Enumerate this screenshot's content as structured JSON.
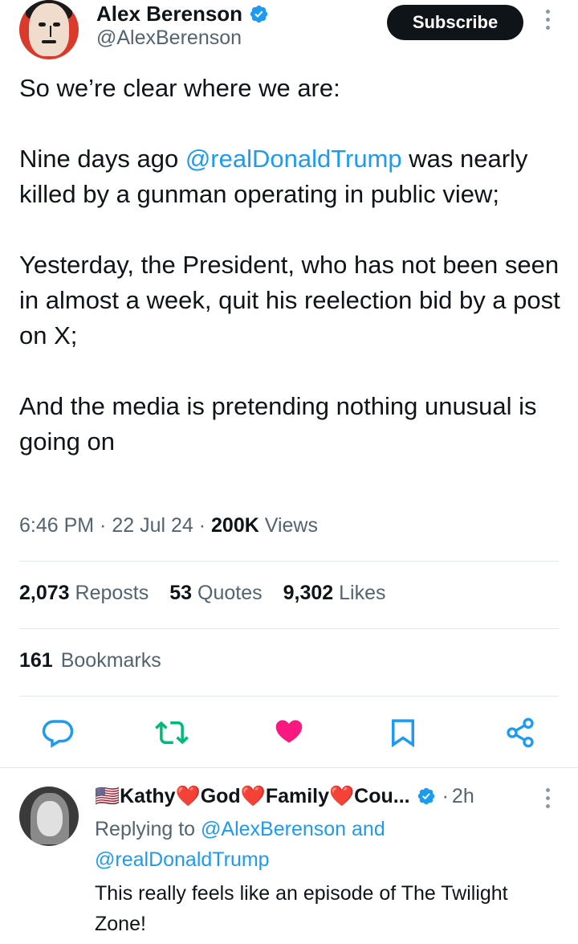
{
  "author": {
    "display_name": "Alex Berenson",
    "handle": "@AlexBerenson",
    "subscribe_label": "Subscribe",
    "avatar_icon": "avatar-photo",
    "verified_icon": "verified-badge-icon"
  },
  "tweet": {
    "line1": "So we’re clear where we are:",
    "p2_before": "Nine days ago ",
    "p2_mention": "@realDonaldTrump",
    "p2_after": " was nearly killed by a gunman operating in public view;",
    "p3": "Yesterday, the President, who has not been seen in almost a week, quit his reelection bid by a post on X;",
    "p4": "And the media is pretending nothing unusual is going on"
  },
  "meta": {
    "time": "6:46 PM",
    "sep1": " · ",
    "date": "22 Jul 24",
    "sep2": " · ",
    "views_count": "200K",
    "views_label": " Views"
  },
  "stats": {
    "reposts_count": "2,073",
    "reposts_label": " Reposts",
    "quotes_count": "53",
    "quotes_label": " Quotes",
    "likes_count": "9,302",
    "likes_label": " Likes",
    "bookmarks_count": "161",
    "bookmarks_label": "Bookmarks"
  },
  "actions": {
    "reply_icon": "reply-icon",
    "repost_icon": "repost-icon",
    "like_icon": "heart-icon",
    "bookmark_icon": "bookmark-icon",
    "share_icon": "share-icon"
  },
  "colors": {
    "mention": "#1d9bf0",
    "like": "#f91880",
    "repost": "#00ba7c",
    "secondary_text": "#536471"
  },
  "reply": {
    "name": "🇺🇸Kathy❤️God❤️Family❤️Cou...",
    "time_sep": "·",
    "time": "2h",
    "replying_prefix": "Replying to ",
    "replying_mention1": "@AlexBerenson",
    "replying_and": " and",
    "replying_mention2": "@realDonaldTrump",
    "text": "This really feels like an episode of The Twilight Zone!"
  }
}
